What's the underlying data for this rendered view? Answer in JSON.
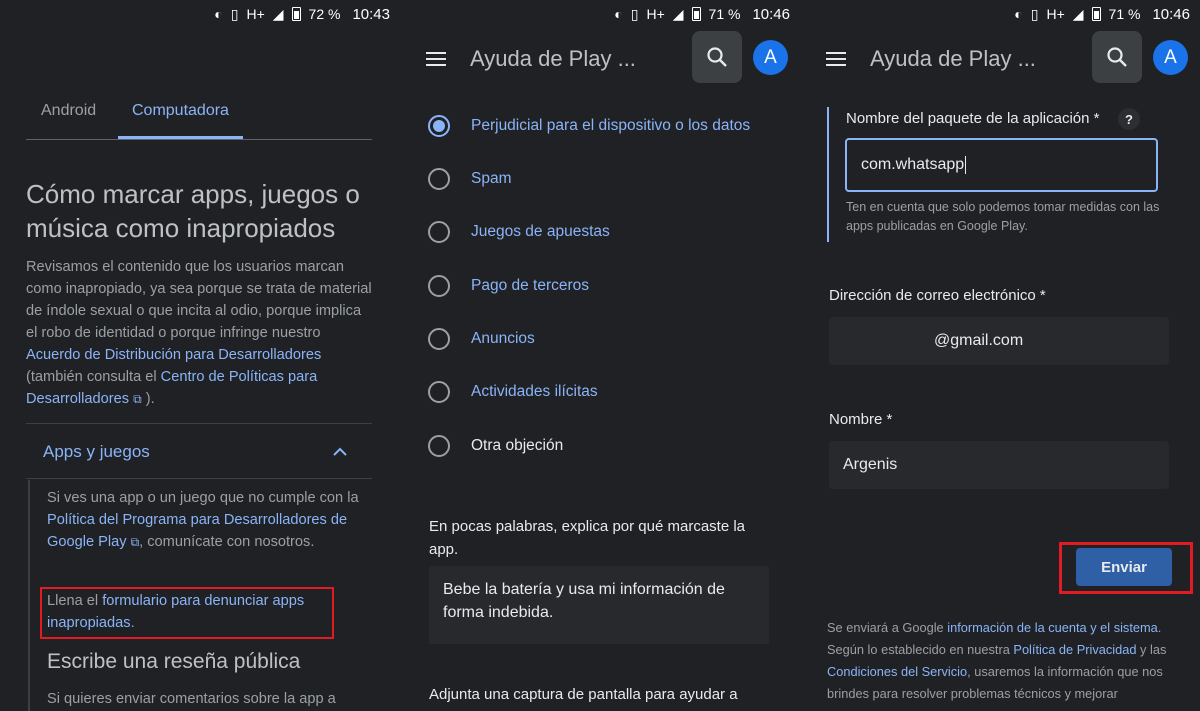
{
  "status": [
    {
      "battery": "72 %",
      "time": "10:43",
      "network": "H+"
    },
    {
      "battery": "71 %",
      "time": "10:46",
      "network": "H+"
    },
    {
      "battery": "71 %",
      "time": "10:46",
      "network": "H+"
    }
  ],
  "appbar": {
    "title": "Ayuda de Play ...",
    "avatar_letter": "A"
  },
  "panel1": {
    "tabs": [
      "Android",
      "Computadora"
    ],
    "heading": "Cómo marcar apps, juegos o música como inapropiados",
    "intro_text": "Revisamos el contenido que los usuarios marcan como inapropiado, ya sea porque se trata de material de índole sexual o que incita al odio, porque implica el robo de identidad o porque infringe nuestro ",
    "intro_link1": "Acuerdo de Distribución para Desarrolladores",
    "intro_mid": " (también consulta el ",
    "intro_link2": "Centro de Políticas para Desarrolladores",
    "intro_end": ").",
    "accordion_title": "Apps y juegos",
    "acc_text1": "Si ves una app o un juego que no cumple con la ",
    "acc_link1": "Política del Programa para Desarrolladores de Google Play",
    "acc_text1_end": ", comunícate con nosotros.",
    "acc_text2": "Llena el ",
    "acc_link2": "formulario para denunciar apps inapropiadas",
    "acc_text2_end": ".",
    "subheading": "Escribe una reseña pública",
    "bottom_text": "Si quieres enviar comentarios sobre la app a"
  },
  "panel2": {
    "options": [
      "Perjudicial para el dispositivo o los datos",
      "Spam",
      "Juegos de apuestas",
      "Pago de terceros",
      "Anuncios",
      "Actividades ilícitas",
      "Otra objeción"
    ],
    "selected_option": "Perjudicial para el dispositivo o los datos",
    "explain_label": "En pocas palabras, explica por qué marcaste la app.",
    "explain_value": "Bebe la batería y usa mi información de forma indebida.",
    "screenshot_label": "Adjunta una captura de pantalla para ayudar a"
  },
  "panel3": {
    "package_label": "Nombre del paquete de la aplicación *",
    "help_icon": "?",
    "package_value": "com.whatsapp",
    "package_hint": "Ten en cuenta que solo podemos tomar medidas con las apps publicadas en Google Play.",
    "email_label": "Dirección de correo electrónico *",
    "email_value": "@gmail.com",
    "name_label": "Nombre *",
    "name_value": "Argenis",
    "send_label": "Enviar",
    "footer1": "Se enviará a Google ",
    "footer_link1": "información de la cuenta y el sistema",
    "footer2": ". Según lo establecido en nuestra ",
    "footer_link2": "Política de Privacidad",
    "footer3": " y las ",
    "footer_link3": "Condiciones del Servicio",
    "footer4": ", usaremos la información que nos brindes para resolver problemas técnicos y mejorar"
  },
  "colors": {
    "accent": "#8ab4f8",
    "background": "#202124",
    "highlight": "#e01b24",
    "button": "#2f5fa5"
  }
}
